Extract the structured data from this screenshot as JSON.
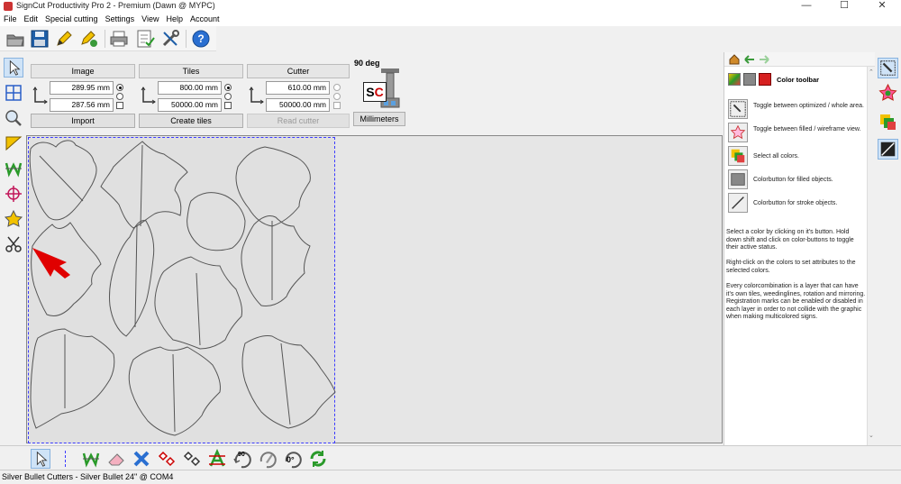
{
  "window": {
    "title": "SignCut Productivity Pro 2 - Premium (Dawn @ MYPC)",
    "minimize": "—",
    "maximize": "☐",
    "close": "✕"
  },
  "menu": [
    "File",
    "Edit",
    "Special cutting",
    "Settings",
    "View",
    "Help",
    "Account"
  ],
  "settings": {
    "image": {
      "title": "Image",
      "width": "289.95 mm",
      "height": "287.56 mm",
      "button": "Import"
    },
    "tiles": {
      "title": "Tiles",
      "width": "800.00 mm",
      "height": "50000.00 mm",
      "button": "Create tiles"
    },
    "cutter": {
      "title": "Cutter",
      "width": "610.00 mm",
      "height": "50000.00 mm",
      "button": "Read cutter"
    },
    "rotation": "90 deg",
    "units_button": "Millimeters",
    "sc_logo": "SC"
  },
  "right_panel": {
    "header": "Color toolbar",
    "rows": [
      {
        "icon": "optimize-area-icon",
        "text": "Toggle between optimized / whole area."
      },
      {
        "icon": "wireframe-toggle-icon",
        "text": "Toggle between filled / wireframe view."
      },
      {
        "icon": "select-all-colors-icon",
        "text": "Select all colors."
      },
      {
        "icon": "filled-colorbutton-icon",
        "text": "Colorbutton for filled objects."
      },
      {
        "icon": "stroke-colorbutton-icon",
        "text": "Colorbutton for stroke objects."
      }
    ],
    "paragraphs": [
      "Select a color by clicking on it's button. Hold down shift and click on color-buttons to toggle their active status.",
      "Right-click on the colors to set attributes to the selected colors.",
      "Every colorcombination is a layer that can have it's own tiles, weedinglines, rotation and mirroring. Registration marks can be enabled or disabled in each layer in order to not collide with the graphic when making multicolored signs."
    ]
  },
  "bottom_toolbar": {
    "rotate_90": "90",
    "rotate_0": "0°"
  },
  "status": "Silver Bullet Cutters - Silver Bullet 24\" @ COM4",
  "colors": {
    "accent_blue": "#3b3bff",
    "pointer_red": "#e00000"
  }
}
